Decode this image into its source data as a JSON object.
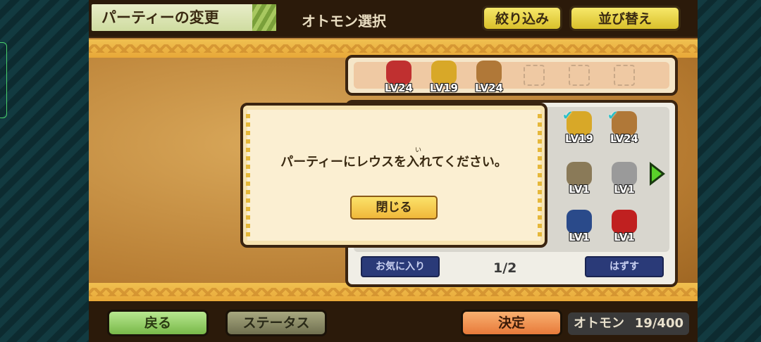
{
  "header": {
    "title": "パーティーの変更",
    "subtitle": "オトモン選択",
    "filter_button": "絞り込み",
    "sort_button": "並び替え"
  },
  "party": [
    {
      "level": "LV24",
      "color": "#c03030"
    },
    {
      "level": "LV19",
      "color": "#d8a828"
    },
    {
      "level": "LV24",
      "color": "#b07838"
    }
  ],
  "list": {
    "monsters": [
      {
        "level": "LV19",
        "color": "#d8a828",
        "checked": true
      },
      {
        "level": "LV24",
        "color": "#b07838",
        "checked": true
      },
      {
        "level": "LV1",
        "color": "#8a7a58",
        "checked": false
      },
      {
        "level": "LV1",
        "color": "#9a9a9a",
        "checked": false
      },
      {
        "level": "LV1",
        "color": "#2a4a8a",
        "checked": false
      },
      {
        "level": "LV1",
        "color": "#c02020",
        "checked": false
      }
    ],
    "favorite_button": "お気に入り",
    "page": "1/2",
    "remove_button": "はずす"
  },
  "dialog": {
    "message": "パーティーにレウスを入れてください。",
    "ruby": "い",
    "close_button": "閉じる"
  },
  "footer": {
    "back_button": "戻る",
    "status_button": "ステータス",
    "confirm_button": "決定",
    "otomon_label": "オトモン",
    "otomon_count": "19/400"
  }
}
